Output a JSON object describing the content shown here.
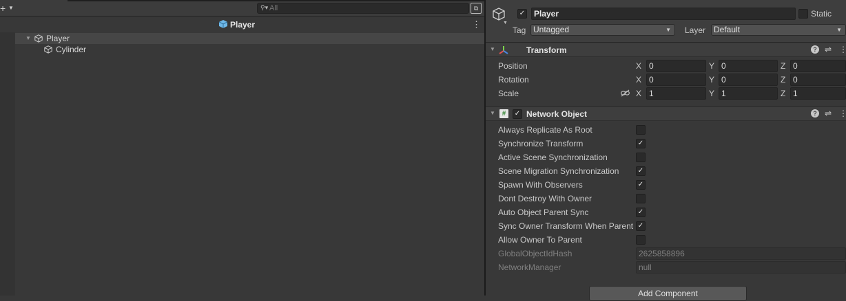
{
  "hierarchy": {
    "add_symbol": "+",
    "search": {
      "placeholder": "All",
      "value": ""
    },
    "scene": {
      "title": "Player"
    },
    "items": [
      {
        "label": "Player",
        "expanded": true
      },
      {
        "label": "Cylinder"
      }
    ]
  },
  "inspector": {
    "gameobject": {
      "active": true,
      "name": "Player",
      "static_label": "Static",
      "static": false,
      "tag_label": "Tag",
      "tag_value": "Untagged",
      "layer_label": "Layer",
      "layer_value": "Default"
    },
    "transform": {
      "title": "Transform",
      "rows": [
        {
          "label": "Position",
          "x": "0",
          "y": "0",
          "z": "0"
        },
        {
          "label": "Rotation",
          "x": "0",
          "y": "0",
          "z": "0"
        },
        {
          "label": "Scale",
          "x": "1",
          "y": "1",
          "z": "1"
        }
      ],
      "axes": {
        "x": "X",
        "y": "Y",
        "z": "Z"
      }
    },
    "network_object": {
      "title": "Network Object",
      "enabled": true,
      "properties": [
        {
          "label": "Always Replicate As Root",
          "checked": false
        },
        {
          "label": "Synchronize Transform",
          "checked": true
        },
        {
          "label": "Active Scene Synchronization",
          "checked": false
        },
        {
          "label": "Scene Migration Synchronization",
          "checked": true
        },
        {
          "label": "Spawn With Observers",
          "checked": true
        },
        {
          "label": "Dont Destroy With Owner",
          "checked": false
        },
        {
          "label": "Auto Object Parent Sync",
          "checked": true
        },
        {
          "label": "Sync Owner Transform When Parent",
          "checked": true
        },
        {
          "label": "Allow Owner To Parent",
          "checked": false
        }
      ],
      "readonly": [
        {
          "label": "GlobalObjectIdHash",
          "value": "2625858896"
        },
        {
          "label": "NetworkManager",
          "value": "null"
        }
      ]
    },
    "add_component_label": "Add Component",
    "icons": {
      "help": "?",
      "more": "⋮"
    }
  },
  "colors": {
    "background": "#383838",
    "header": "#3e3e3e",
    "field": "#2a2a2a",
    "selection_row": "#464646",
    "scene_icon": "#6fb8e8"
  }
}
